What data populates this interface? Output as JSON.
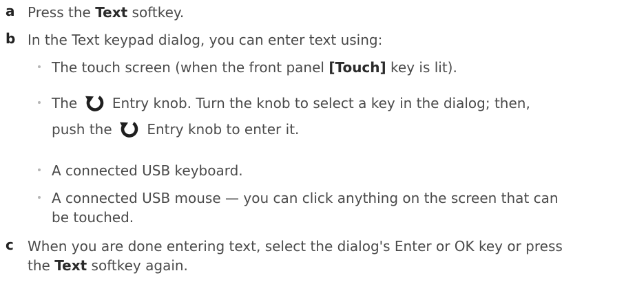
{
  "steps": [
    {
      "letter": "a",
      "pre": "Press the ",
      "bold": "Text",
      "post": " softkey."
    },
    {
      "letter": "b",
      "text": "In the Text keypad dialog, you can enter text using:",
      "bullets": [
        {
          "pre": "The touch screen (when the front panel ",
          "bold": "[Touch]",
          "post": " key is lit)."
        },
        {
          "pre": "The ",
          "icon1": "entry-knob-icon",
          "mid": " Entry knob. Turn the knob to select a key in the dialog; then,",
          "line2_pre": "push the ",
          "icon2": "entry-knob-icon",
          "line2_post": " Entry knob to enter it."
        },
        {
          "text": "A connected USB keyboard."
        },
        {
          "line1": "A connected USB mouse — you can click anything on the screen that can",
          "line2": "be touched."
        }
      ]
    },
    {
      "letter": "c",
      "line1": "When you are done entering text, select the dialog's Enter or OK key or press",
      "line2_pre": "the ",
      "line2_bold": "Text",
      "line2_post": " softkey again."
    }
  ]
}
